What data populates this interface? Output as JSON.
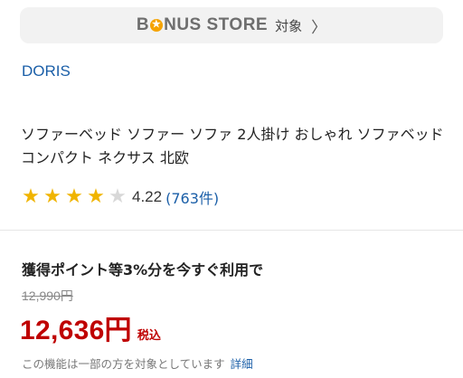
{
  "bonus_banner": {
    "bonus_left": "B",
    "bonus_right": "NUS STORE",
    "target_label": "対象",
    "chevron": "〉",
    "icon": "chevron-right-icon",
    "accent_color": "#f5a300"
  },
  "product": {
    "brand": "DORIS",
    "title": "ソファーベッド ソファー ソファ 2人掛け おしゃれ ソファベッド コンパクト ネクサス 北欧",
    "rating": {
      "value": 4.22,
      "score_text": "4.22",
      "count_text": "(763件)",
      "stars": [
        "★",
        "★",
        "★",
        "★",
        "★"
      ],
      "filled_stars": 4,
      "star_color": "#f0b400"
    }
  },
  "pricing": {
    "points_text": "獲得ポイント等3%分を今すぐ利用で",
    "original_price": "12,990円",
    "price": "12,636円",
    "tax_label": "税込",
    "note": "この機能は一部の方を対象としています",
    "note_link": "詳細",
    "price_color": "#bf0000"
  }
}
